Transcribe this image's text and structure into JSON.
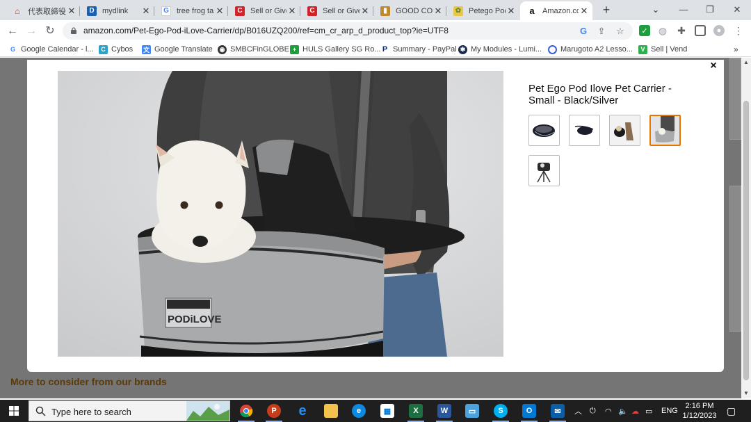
{
  "browser": {
    "tabs": [
      {
        "title": "代表取締役",
        "favicon": "red-logo-icon",
        "color": "#d93025"
      },
      {
        "title": "mydlink",
        "favicon": "mydlink-icon",
        "color": "#1a5fb4"
      },
      {
        "title": "tree frog ta",
        "favicon": "google-icon",
        "color": "#4285f4"
      },
      {
        "title": "Sell or Give",
        "favicon": "carousell-icon",
        "color": "#d2232a"
      },
      {
        "title": "Sell or Give",
        "favicon": "carousell-icon",
        "color": "#d2232a"
      },
      {
        "title": "GOOD CO",
        "favicon": "shopping-bag-icon",
        "color": "#c08a2c"
      },
      {
        "title": "Petego Pod",
        "favicon": "petego-icon",
        "color": "#e8c84a"
      },
      {
        "title": "Amazon.co",
        "favicon": "amazon-icon",
        "color": "#111111",
        "active": true
      }
    ],
    "url": "amazon.com/Pet-Ego-Pod-iLove-Carrier/dp/B016UZQ200/ref=cm_cr_arp_d_product_top?ie=UTF8",
    "bookmarks": [
      {
        "label": "Google Calendar - l...",
        "icon": "google-icon",
        "color": "#4285f4"
      },
      {
        "label": "Cybos",
        "icon": "cybos-icon",
        "color": "#29a3c9"
      },
      {
        "label": "Google Translate",
        "icon": "translate-icon",
        "color": "#4285f4"
      },
      {
        "label": "SMBCFinGLOBE",
        "icon": "globe-icon",
        "color": "#333333"
      },
      {
        "label": "HULS Gallery SG Ro...",
        "icon": "huls-icon",
        "color": "#1e9e3e"
      },
      {
        "label": "Summary - PayPal",
        "icon": "paypal-icon",
        "color": "#003087"
      },
      {
        "label": "My Modules - Lumi...",
        "icon": "lumi-icon",
        "color": "#1b2a4a"
      },
      {
        "label": "Marugoto A2 Lesso...",
        "icon": "marugoto-icon",
        "color": "#3b5bdb"
      },
      {
        "label": "Sell | Vend",
        "icon": "vend-icon",
        "color": "#2eae4f"
      }
    ]
  },
  "modal": {
    "product_title": "Pet Ego Pod Ilove Pet Carrier - Small - Black/Silver",
    "close_label": "×",
    "thumbnails": [
      {
        "name": "thumb-carrier-top",
        "selected": false
      },
      {
        "name": "thumb-carrier-side",
        "selected": false
      },
      {
        "name": "thumb-dog-carrier",
        "selected": false
      },
      {
        "name": "thumb-dog-in-pod",
        "selected": true
      },
      {
        "name": "thumb-tripod-stand",
        "selected": false
      }
    ],
    "photo_logo_text": "PODiLOVE"
  },
  "page": {
    "section_heading": "More to consider from our brands"
  },
  "taskbar": {
    "search_placeholder": "Type here to search",
    "language": "ENG",
    "time": "2:16 PM",
    "date": "1/12/2023"
  },
  "colors": {
    "accent_selected": "#e77600",
    "overlay": "#757575",
    "brand_heading": "#5c3a06"
  }
}
